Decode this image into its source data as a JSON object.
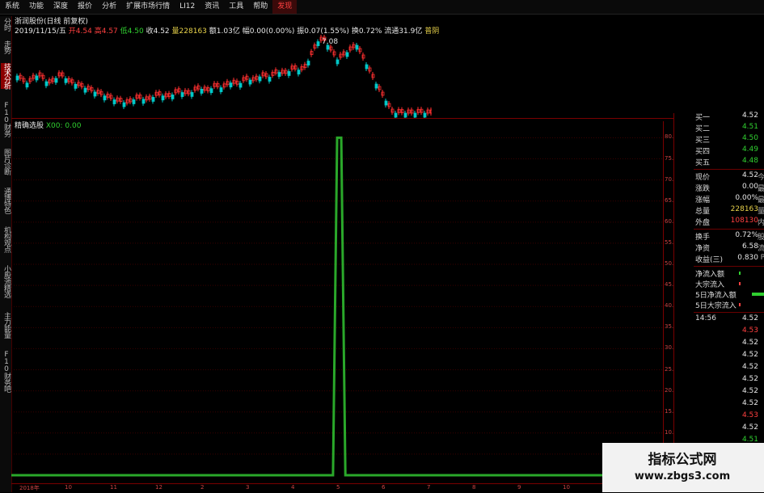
{
  "menu": [
    "系统",
    "功能",
    "深度",
    "报价",
    "分析",
    "扩展市场行情",
    "LI12",
    "资讯",
    "工具",
    "帮助",
    "发现"
  ],
  "menu_active_index": 10,
  "left_tabs": [
    "分时",
    "走势",
    "技术分析",
    "F10财务",
    "图片诊断",
    "通博特色",
    "机构观点",
    "小股池精选",
    "主力能量",
    "F10财务吧"
  ],
  "left_tab_selected": 2,
  "stock_title": "浙润股份(日线 前复权)",
  "kline_info": {
    "date": "2019/11/15/五",
    "open_label": "开",
    "open": "4.54",
    "high_label": "高",
    "high": "4.57",
    "low_label": "低",
    "low": "4.50",
    "close_label": "收",
    "close": "4.52",
    "vol_label": "量",
    "vol": "228163",
    "amount_label": "额",
    "amount": "1.03亿",
    "change_label": "幅",
    "change": "0.00(0.00%)",
    "amplitude_label": "振",
    "amplitude": "0.07(1.55%)",
    "turnover_label": "换",
    "turnover": "0.72%",
    "float_label": "流通",
    "float": "31.9亿",
    "extra": "普阴"
  },
  "peak_label": "7.08",
  "indicator_title": "精确选股",
  "indicator_value": "X00: 0.00",
  "y_axis_ticks": [
    "80.00",
    "75.00",
    "70.00",
    "65.00",
    "60.00",
    "55.00",
    "50.00",
    "45.00",
    "40.00",
    "35.00",
    "30.00",
    "25.00",
    "20.00",
    "15.00",
    "10.00",
    "5.00"
  ],
  "x_axis_ticks": [
    "2018年",
    "10",
    "11",
    "12",
    "2",
    "3",
    "4",
    "5",
    "6",
    "7",
    "8",
    "9",
    "10"
  ],
  "chart_data": {
    "type": "line",
    "title": "精确选股",
    "series": [
      {
        "name": "X00",
        "values": [
          0,
          0,
          0,
          0,
          0,
          0,
          0,
          0,
          0,
          0,
          0,
          0,
          0,
          0,
          0,
          0,
          0,
          0,
          0,
          0,
          0,
          0,
          0,
          0,
          0,
          0,
          0,
          0,
          0,
          0,
          0,
          0,
          0,
          0,
          0,
          0,
          0,
          0,
          0,
          0,
          0,
          0,
          0,
          0,
          0,
          0,
          0,
          0,
          0,
          0,
          0,
          0,
          0,
          0,
          0,
          0,
          0,
          0,
          0,
          0,
          0,
          0,
          0,
          0,
          0,
          0,
          0,
          0,
          0,
          0,
          0,
          0,
          0,
          0,
          0,
          0,
          0,
          0,
          0,
          80,
          80,
          0,
          0,
          0,
          0,
          0,
          0,
          0,
          0,
          0,
          0,
          0,
          0,
          0,
          0,
          0,
          0,
          0,
          0,
          0,
          0,
          0,
          0,
          0,
          0,
          0,
          0,
          0,
          0,
          0,
          0,
          0,
          0,
          0,
          0,
          0,
          0,
          0,
          0,
          0,
          0,
          0,
          0,
          0,
          0,
          0,
          0,
          0,
          0,
          0,
          0,
          0,
          0,
          0,
          0,
          0,
          0,
          0,
          0,
          0,
          0,
          0,
          0,
          0,
          0,
          0,
          0,
          0,
          0,
          0,
          0,
          0,
          0,
          0,
          0,
          0,
          0,
          0,
          0
        ]
      }
    ],
    "ylim": [
      0,
      82
    ]
  },
  "quote": {
    "buy": [
      {
        "label": "买一",
        "price": "4.52"
      },
      {
        "label": "买二",
        "price": "4.51"
      },
      {
        "label": "买三",
        "price": "4.50"
      },
      {
        "label": "买四",
        "price": "4.49"
      },
      {
        "label": "买五",
        "price": "4.48"
      }
    ],
    "stats": [
      {
        "label": "现价",
        "value": "4.52",
        "x": "今"
      },
      {
        "label": "涨跌",
        "value": "0.00",
        "x": "最"
      },
      {
        "label": "涨幅",
        "value": "0.00%",
        "x": "最"
      },
      {
        "label": "总量",
        "value": "228163",
        "x": "量"
      },
      {
        "label": "外盘",
        "value": "108130",
        "x": "内"
      }
    ],
    "stats2": [
      {
        "label": "换手",
        "value": "0.72%",
        "x": "股"
      },
      {
        "label": "净资",
        "value": "6.58",
        "x": "流"
      },
      {
        "label": "收益(三)",
        "value": "0.830",
        "x": "P"
      }
    ],
    "flows": [
      "净流入额",
      "大宗流入",
      "5日净流入额",
      "5日大宗流入"
    ],
    "ticks": [
      {
        "time": "14:56",
        "price": "4.52",
        "color": "white"
      },
      {
        "time": "",
        "price": "4.53",
        "color": "red"
      },
      {
        "time": "",
        "price": "4.52",
        "color": "white"
      },
      {
        "time": "",
        "price": "4.52",
        "color": "white"
      },
      {
        "time": "",
        "price": "4.52",
        "color": "white"
      },
      {
        "time": "",
        "price": "4.52",
        "color": "white"
      },
      {
        "time": "",
        "price": "4.52",
        "color": "white"
      },
      {
        "time": "",
        "price": "4.52",
        "color": "white"
      },
      {
        "time": "",
        "price": "4.53",
        "color": "red"
      },
      {
        "time": "",
        "price": "4.52",
        "color": "white"
      },
      {
        "time": "",
        "price": "4.51",
        "color": "green"
      }
    ]
  },
  "watermark": {
    "title": "指标公式网",
    "url": "www.zbgs3.com"
  }
}
